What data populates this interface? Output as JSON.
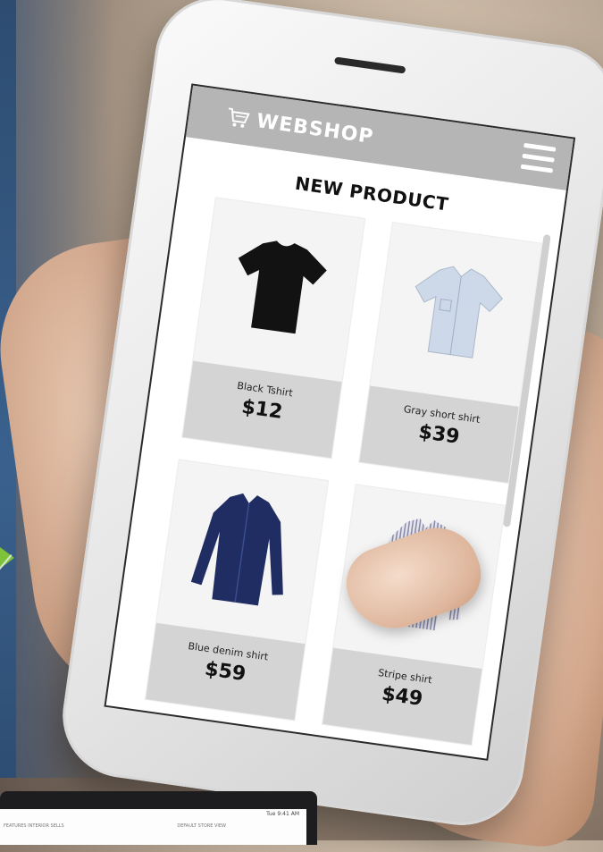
{
  "app": {
    "logo": "WEBSHOP",
    "menu_icon": "hamburger-menu-icon",
    "cart_icon": "shopping-cart-icon"
  },
  "section": {
    "heading": "NEW PRODUCT"
  },
  "products": [
    {
      "name": "Black Tshirt",
      "price": "$12",
      "color": "#111111"
    },
    {
      "name": "Gray short shirt",
      "price": "$39",
      "color": "#c9d6e6"
    },
    {
      "name": "Blue denim shirt",
      "price": "$59",
      "color": "#1f2d63"
    },
    {
      "name": "Stripe shirt",
      "price": "$49",
      "color": "#d8d8e6"
    }
  ],
  "laptop": {
    "status_text": "Tue 9:41 AM",
    "nav_items": "FEATURES  INTERIOR  SELLS",
    "nav_right": "DEFAULT STORE VIEW"
  },
  "colors": {
    "topbar": "#b5b5b5",
    "info_bg": "#d4d4d4",
    "accent_arrow": "#7ec23a",
    "panel_blue": "#3a618e"
  }
}
